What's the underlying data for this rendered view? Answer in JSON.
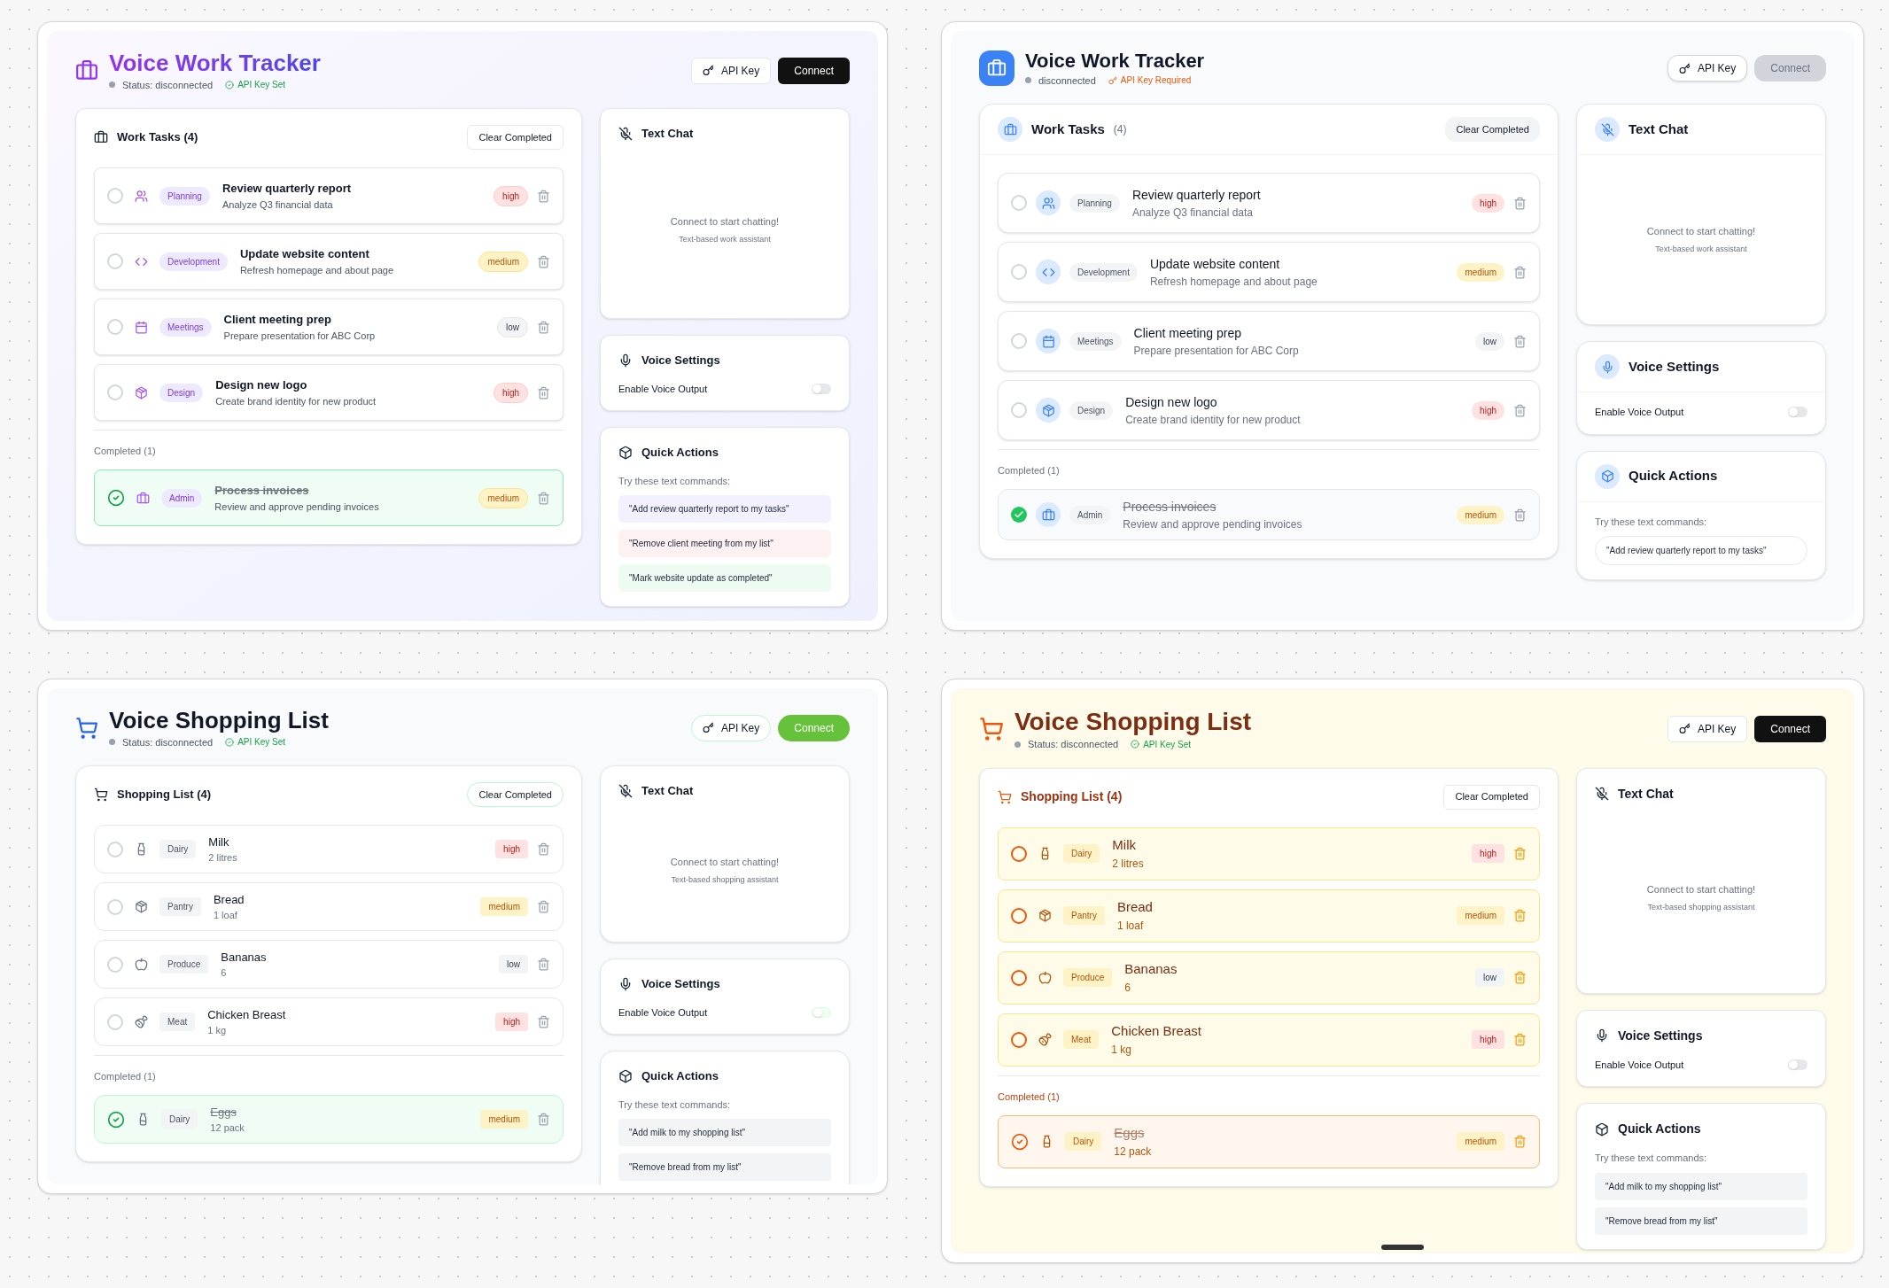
{
  "panels": [
    {
      "kind": "purple",
      "title": "Voice Work Tracker",
      "status": "Status: disconnected",
      "api_status": {
        "kind": "set",
        "label": "API Key Set"
      },
      "api_key_button": "API Key",
      "connect_button": {
        "label": "Connect",
        "disabled": false
      },
      "list": {
        "title": "Work Tasks (4)",
        "clear_button": "Clear Completed",
        "items": [
          {
            "title": "Review quarterly report",
            "subtitle": "Analyze Q3 financial data",
            "category": "Planning",
            "priority": {
              "label": "high",
              "kind": "high"
            },
            "checked": false
          },
          {
            "title": "Update website content",
            "subtitle": "Refresh homepage and about page",
            "category": "Development",
            "priority": {
              "label": "medium",
              "kind": "medium"
            },
            "checked": false
          },
          {
            "title": "Client meeting prep",
            "subtitle": "Prepare presentation for ABC Corp",
            "category": "Meetings",
            "priority": {
              "label": "low",
              "kind": "low"
            },
            "checked": false
          },
          {
            "title": "Design new logo",
            "subtitle": "Create brand identity for new product",
            "category": "Design",
            "priority": {
              "label": "high",
              "kind": "high"
            },
            "checked": false
          }
        ],
        "completed": {
          "label": "Completed (1)",
          "items": [
            {
              "title": "Process invoices",
              "subtitle": "Review and approve pending invoices",
              "category": "Admin",
              "priority": {
                "label": "medium",
                "kind": "medium"
              },
              "checked": true
            }
          ]
        }
      },
      "chat": {
        "title": "Text Chat",
        "empty": "Connect to start chatting!",
        "hint": "Text-based work assistant"
      },
      "voice": {
        "title": "Voice Settings",
        "label": "Enable Voice Output",
        "on": false
      },
      "quick_actions": {
        "title": "Quick Actions",
        "intro": "Try these text commands:",
        "commands": [
          {
            "text": "\"Add review quarterly report to my tasks\"",
            "color": "#f3f1fe"
          },
          {
            "text": "\"Remove client meeting from my list\"",
            "color": "#fdf1f2"
          },
          {
            "text": "\"Mark website update as completed\"",
            "color": "#eefbf3"
          }
        ]
      }
    },
    {
      "kind": "blue",
      "title": "Voice Work Tracker",
      "status": "disconnected",
      "api_status": {
        "kind": "required",
        "label": "API Key Required"
      },
      "api_key_button": "API Key",
      "connect_button": {
        "label": "Connect",
        "disabled": true
      },
      "list": {
        "title": "Work Tasks",
        "count": "(4)",
        "clear_button": "Clear Completed",
        "items": [
          {
            "title": "Review quarterly report",
            "subtitle": "Analyze Q3 financial data",
            "category": "Planning",
            "priority": {
              "label": "high",
              "kind": "high"
            },
            "checked": false
          },
          {
            "title": "Update website content",
            "subtitle": "Refresh homepage and about page",
            "category": "Development",
            "priority": {
              "label": "medium",
              "kind": "medium"
            },
            "checked": false
          },
          {
            "title": "Client meeting prep",
            "subtitle": "Prepare presentation for ABC Corp",
            "category": "Meetings",
            "priority": {
              "label": "low",
              "kind": "low"
            },
            "checked": false
          },
          {
            "title": "Design new logo",
            "subtitle": "Create brand identity for new product",
            "category": "Design",
            "priority": {
              "label": "high",
              "kind": "high"
            },
            "checked": false
          }
        ],
        "completed": {
          "label": "Completed (1)",
          "items": [
            {
              "title": "Process invoices",
              "subtitle": "Review and approve pending invoices",
              "category": "Admin",
              "priority": {
                "label": "medium",
                "kind": "medium"
              },
              "checked": true
            }
          ]
        }
      },
      "chat": {
        "title": "Text Chat",
        "empty": "Connect to start chatting!",
        "hint": "Text-based work assistant"
      },
      "voice": {
        "title": "Voice Settings",
        "label": "Enable Voice Output",
        "on": false
      },
      "quick_actions": {
        "title": "Quick Actions",
        "intro": "Try these text commands:",
        "commands": [
          {
            "text": "\"Add review quarterly report to my tasks\""
          }
        ]
      }
    },
    {
      "kind": "green",
      "title": "Voice Shopping List",
      "status": "Status: disconnected",
      "api_status": {
        "kind": "set",
        "label": "API Key Set"
      },
      "api_key_button": "API Key",
      "connect_button": {
        "label": "Connect",
        "disabled": false
      },
      "list": {
        "title": "Shopping List (4)",
        "clear_button": "Clear Completed",
        "items": [
          {
            "title": "Milk",
            "subtitle": "2 litres",
            "category": "Dairy",
            "priority": {
              "label": "high",
              "kind": "high"
            },
            "checked": false
          },
          {
            "title": "Bread",
            "subtitle": "1 loaf",
            "category": "Pantry",
            "priority": {
              "label": "medium",
              "kind": "medium"
            },
            "checked": false
          },
          {
            "title": "Bananas",
            "subtitle": "6",
            "category": "Produce",
            "priority": {
              "label": "low",
              "kind": "low"
            },
            "checked": false
          },
          {
            "title": "Chicken Breast",
            "subtitle": "1 kg",
            "category": "Meat",
            "priority": {
              "label": "high",
              "kind": "high"
            },
            "checked": false
          }
        ],
        "completed": {
          "label": "Completed (1)",
          "items": [
            {
              "title": "Eggs",
              "subtitle": "12 pack",
              "category": "Dairy",
              "priority": {
                "label": "medium",
                "kind": "medium"
              },
              "checked": true
            }
          ]
        }
      },
      "chat": {
        "title": "Text Chat",
        "empty": "Connect to start chatting!",
        "hint": "Text-based shopping assistant"
      },
      "voice": {
        "title": "Voice Settings",
        "label": "Enable Voice Output",
        "on": false
      },
      "quick_actions": {
        "title": "Quick Actions",
        "intro": "Try these text commands:",
        "commands": [
          {
            "text": "\"Add milk to my shopping list\""
          },
          {
            "text": "\"Remove bread from my list\""
          }
        ]
      }
    },
    {
      "kind": "amber",
      "title": "Voice Shopping List",
      "status": "Status: disconnected",
      "api_status": {
        "kind": "set",
        "label": "API Key Set"
      },
      "api_key_button": "API Key",
      "connect_button": {
        "label": "Connect",
        "disabled": false
      },
      "list": {
        "title": "Shopping List (4)",
        "clear_button": "Clear Completed",
        "items": [
          {
            "title": "Milk",
            "subtitle": "2 litres",
            "category": "Dairy",
            "priority": {
              "label": "high",
              "kind": "high"
            },
            "checked": false
          },
          {
            "title": "Bread",
            "subtitle": "1 loaf",
            "category": "Pantry",
            "priority": {
              "label": "medium",
              "kind": "medium"
            },
            "checked": false
          },
          {
            "title": "Bananas",
            "subtitle": "6",
            "category": "Produce",
            "priority": {
              "label": "low",
              "kind": "low"
            },
            "checked": false
          },
          {
            "title": "Chicken Breast",
            "subtitle": "1 kg",
            "category": "Meat",
            "priority": {
              "label": "high",
              "kind": "high"
            },
            "checked": false
          }
        ],
        "completed": {
          "label": "Completed (1)",
          "items": [
            {
              "title": "Eggs",
              "subtitle": "12 pack",
              "category": "Dairy",
              "priority": {
                "label": "medium",
                "kind": "medium"
              },
              "checked": true
            }
          ]
        }
      },
      "chat": {
        "title": "Text Chat",
        "empty": "Connect to start chatting!",
        "hint": "Text-based shopping assistant"
      },
      "voice": {
        "title": "Voice Settings",
        "label": "Enable Voice Output",
        "on": false
      },
      "quick_actions": {
        "title": "Quick Actions",
        "intro": "Try these text commands:",
        "commands": [
          {
            "text": "\"Add milk to my shopping list\""
          },
          {
            "text": "\"Remove bread from my list\""
          }
        ]
      }
    }
  ]
}
